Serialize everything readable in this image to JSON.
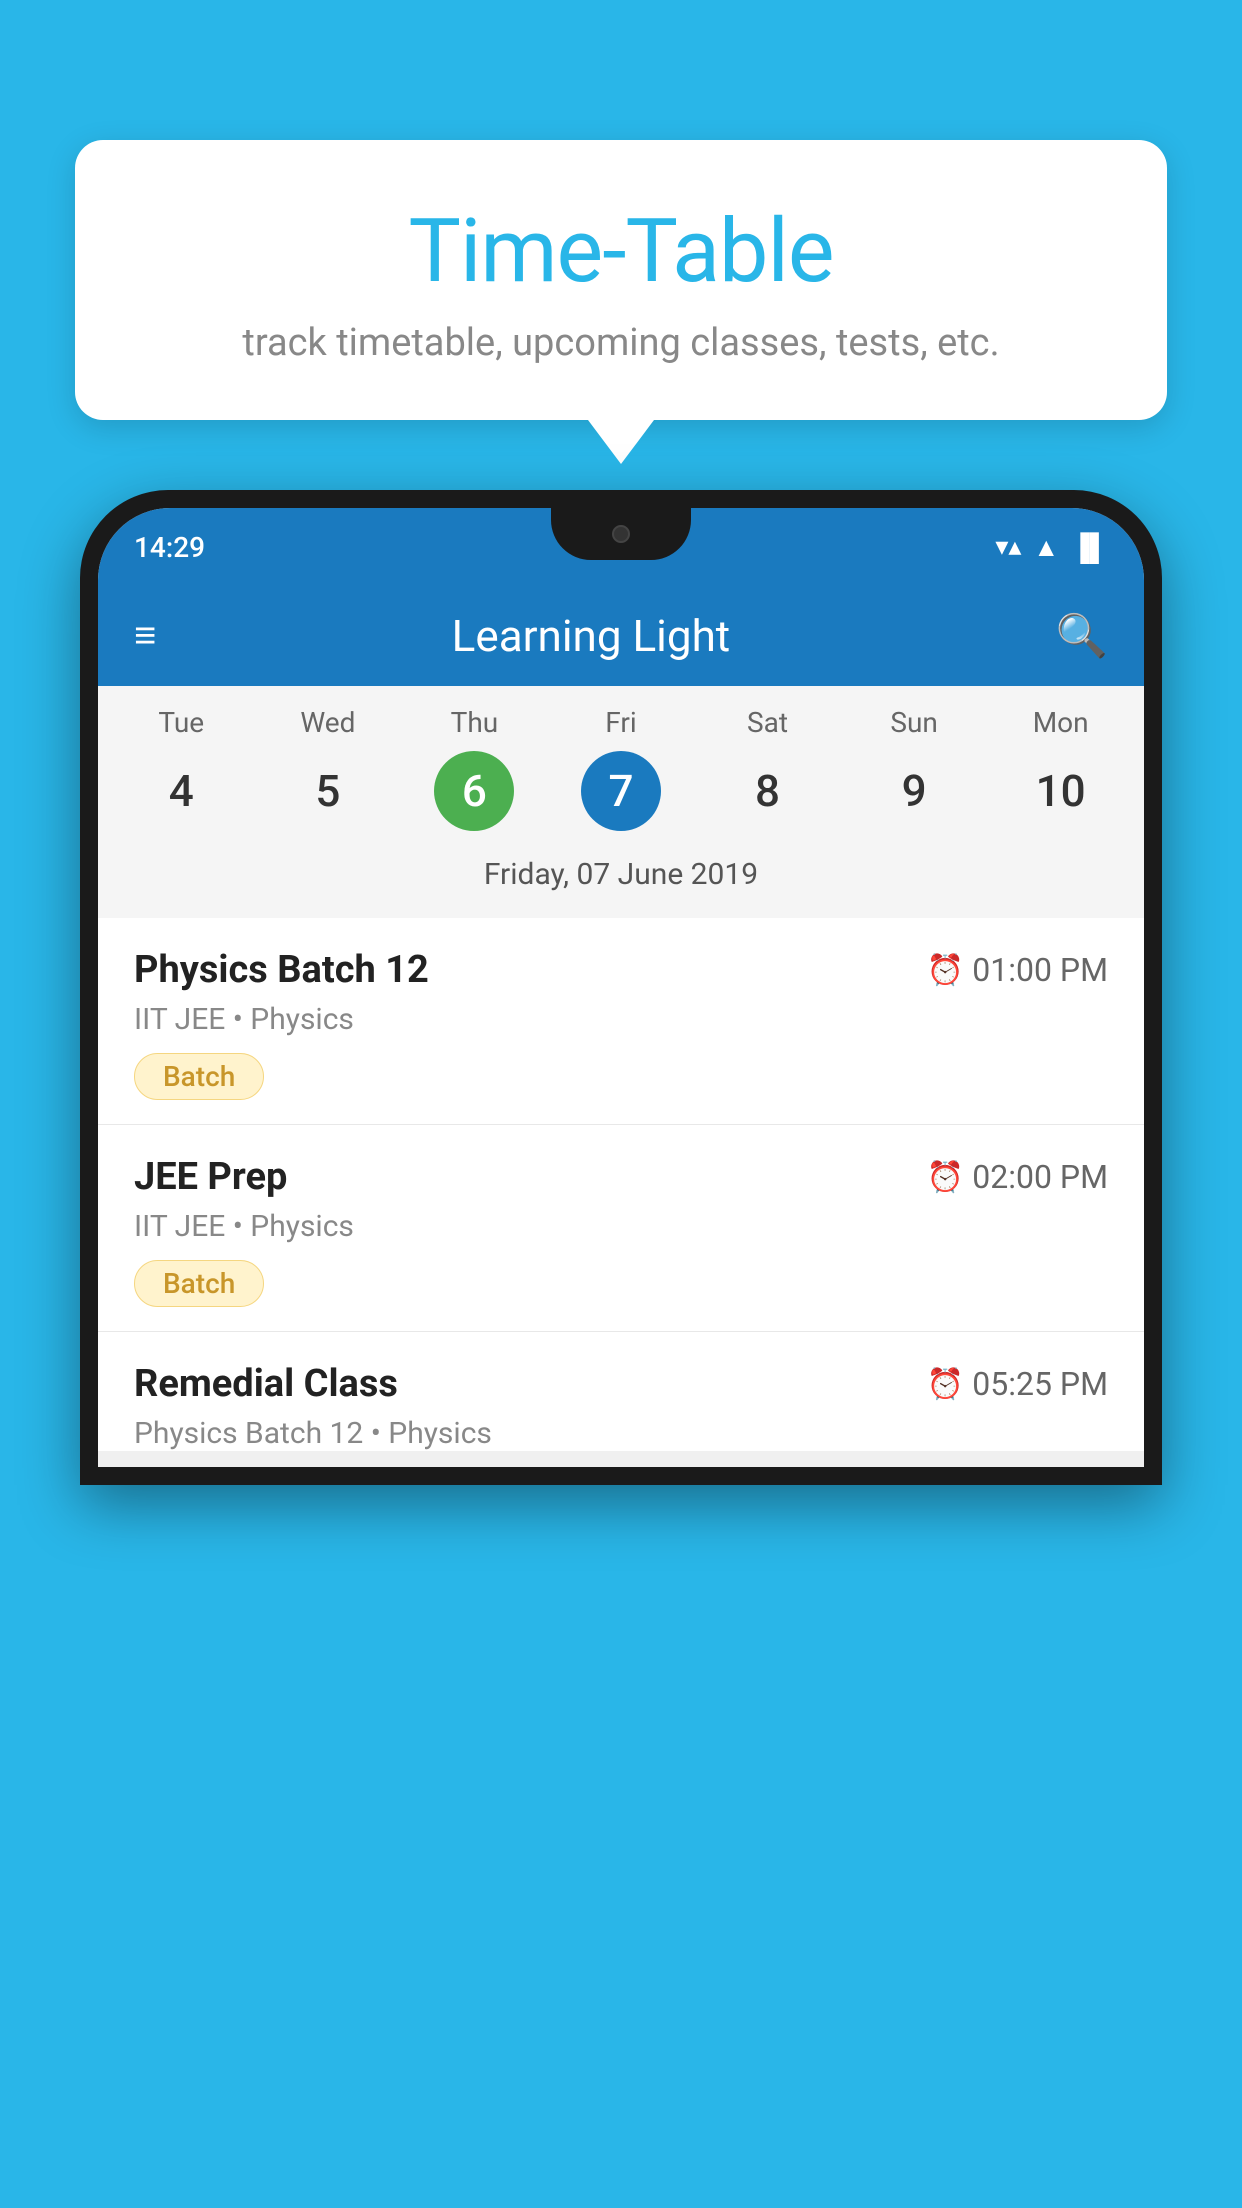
{
  "background_color": "#29b6e8",
  "tooltip": {
    "title": "Time-Table",
    "subtitle": "track timetable, upcoming classes, tests, etc."
  },
  "phone": {
    "status_bar": {
      "time": "14:29",
      "wifi": "▼▲",
      "signal": "▲",
      "battery": "▐"
    },
    "app_bar": {
      "title": "Learning Light",
      "hamburger_label": "≡",
      "search_label": "🔍"
    },
    "calendar": {
      "days": [
        {
          "name": "Tue",
          "num": "4",
          "state": "normal"
        },
        {
          "name": "Wed",
          "num": "5",
          "state": "normal"
        },
        {
          "name": "Thu",
          "num": "6",
          "state": "today"
        },
        {
          "name": "Fri",
          "num": "7",
          "state": "selected"
        },
        {
          "name": "Sat",
          "num": "8",
          "state": "normal"
        },
        {
          "name": "Sun",
          "num": "9",
          "state": "normal"
        },
        {
          "name": "Mon",
          "num": "10",
          "state": "normal"
        }
      ],
      "selected_date": "Friday, 07 June 2019"
    },
    "schedule": [
      {
        "title": "Physics Batch 12",
        "time": "01:00 PM",
        "subtitle": "IIT JEE • Physics",
        "badge": "Batch"
      },
      {
        "title": "JEE Prep",
        "time": "02:00 PM",
        "subtitle": "IIT JEE • Physics",
        "badge": "Batch"
      },
      {
        "title": "Remedial Class",
        "time": "05:25 PM",
        "subtitle": "Physics Batch 12 • Physics",
        "badge": null
      }
    ]
  }
}
